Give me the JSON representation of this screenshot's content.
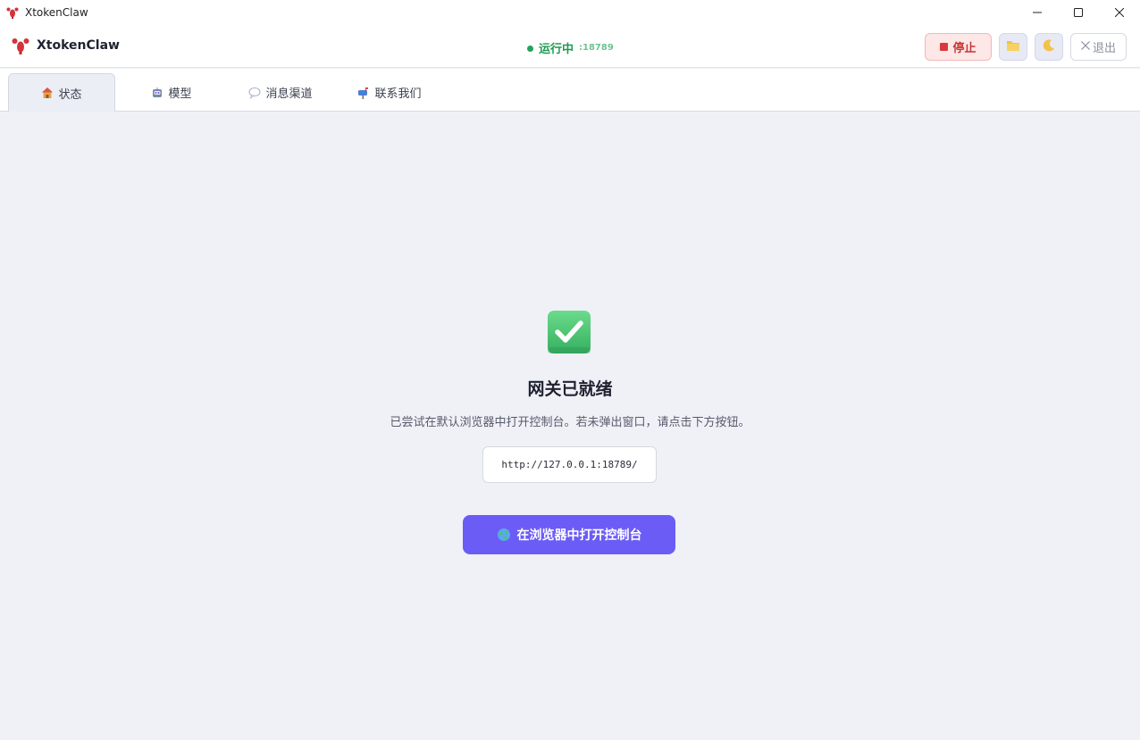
{
  "window": {
    "title": "XtokenClaw",
    "app_icon": "lobster-icon",
    "controls": [
      "minimize-icon",
      "maximize-icon",
      "close-icon"
    ]
  },
  "header": {
    "brand_name": "XtokenClaw",
    "status_label": "运行中",
    "status_port": ":18789",
    "stop_label": "停止",
    "exit_label": "退出",
    "folder_icon": "folder-icon",
    "theme_icon": "moon-icon"
  },
  "tabs": [
    {
      "label": "状态",
      "icon": "house-icon",
      "active": true
    },
    {
      "label": "模型",
      "icon": "robot-icon",
      "active": false
    },
    {
      "label": "消息渠道",
      "icon": "speech-bubble-icon",
      "active": false
    },
    {
      "label": "联系我们",
      "icon": "mailbox-icon",
      "active": false
    }
  ],
  "main": {
    "status_icon": "check-mark-icon",
    "heading": "网关已就绪",
    "description": "已尝试在默认浏览器中打开控制台。若未弹出窗口，请点击下方按钮。",
    "url": "http://127.0.0.1:18789/",
    "open_button_label": "在浏览器中打开控制台",
    "open_button_icon": "globe-icon"
  },
  "colors": {
    "accent": "#6b5cf6",
    "running": "#1f9a52",
    "stop": "#d9383a",
    "background": "#f0f1f7"
  }
}
